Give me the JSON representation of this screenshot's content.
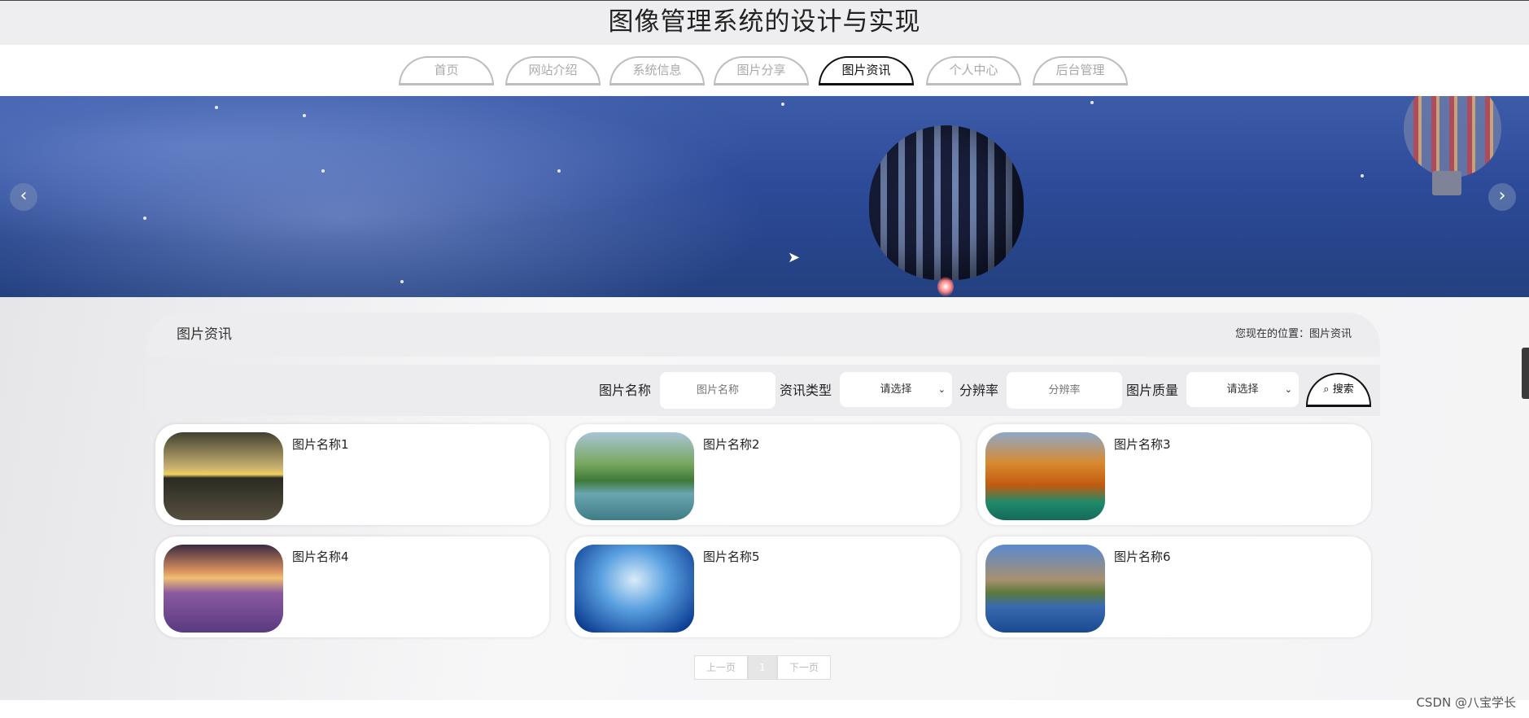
{
  "header": {
    "title": "图像管理系统的设计与实现"
  },
  "nav": {
    "items": [
      {
        "label": "首页"
      },
      {
        "label": "网站介绍"
      },
      {
        "label": "系统信息"
      },
      {
        "label": "图片分享"
      },
      {
        "label": "图片资讯"
      },
      {
        "label": "个人中心"
      },
      {
        "label": "后台管理"
      }
    ],
    "active": "图片资讯"
  },
  "banner": {
    "prev_icon": "chevron-left-icon",
    "next_icon": "chevron-right-icon"
  },
  "section": {
    "title": "图片资讯",
    "breadcrumb_prefix": "您现在的位置：",
    "breadcrumb_current": "图片资讯"
  },
  "search": {
    "name_label": "图片名称",
    "name_placeholder": "图片名称",
    "type_label": "资讯类型",
    "type_value": "请选择",
    "resolution_label": "分辨率",
    "resolution_placeholder": "分辨率",
    "quality_label": "图片质量",
    "quality_value": "请选择",
    "button_label": "搜索"
  },
  "cards": [
    {
      "name": "图片名称1"
    },
    {
      "name": "图片名称2"
    },
    {
      "name": "图片名称3"
    },
    {
      "name": "图片名称4"
    },
    {
      "name": "图片名称5"
    },
    {
      "name": "图片名称6"
    }
  ],
  "pagination": {
    "prev": "上一页",
    "page": "1",
    "next": "下一页"
  },
  "watermark": "CSDN @八宝学长"
}
